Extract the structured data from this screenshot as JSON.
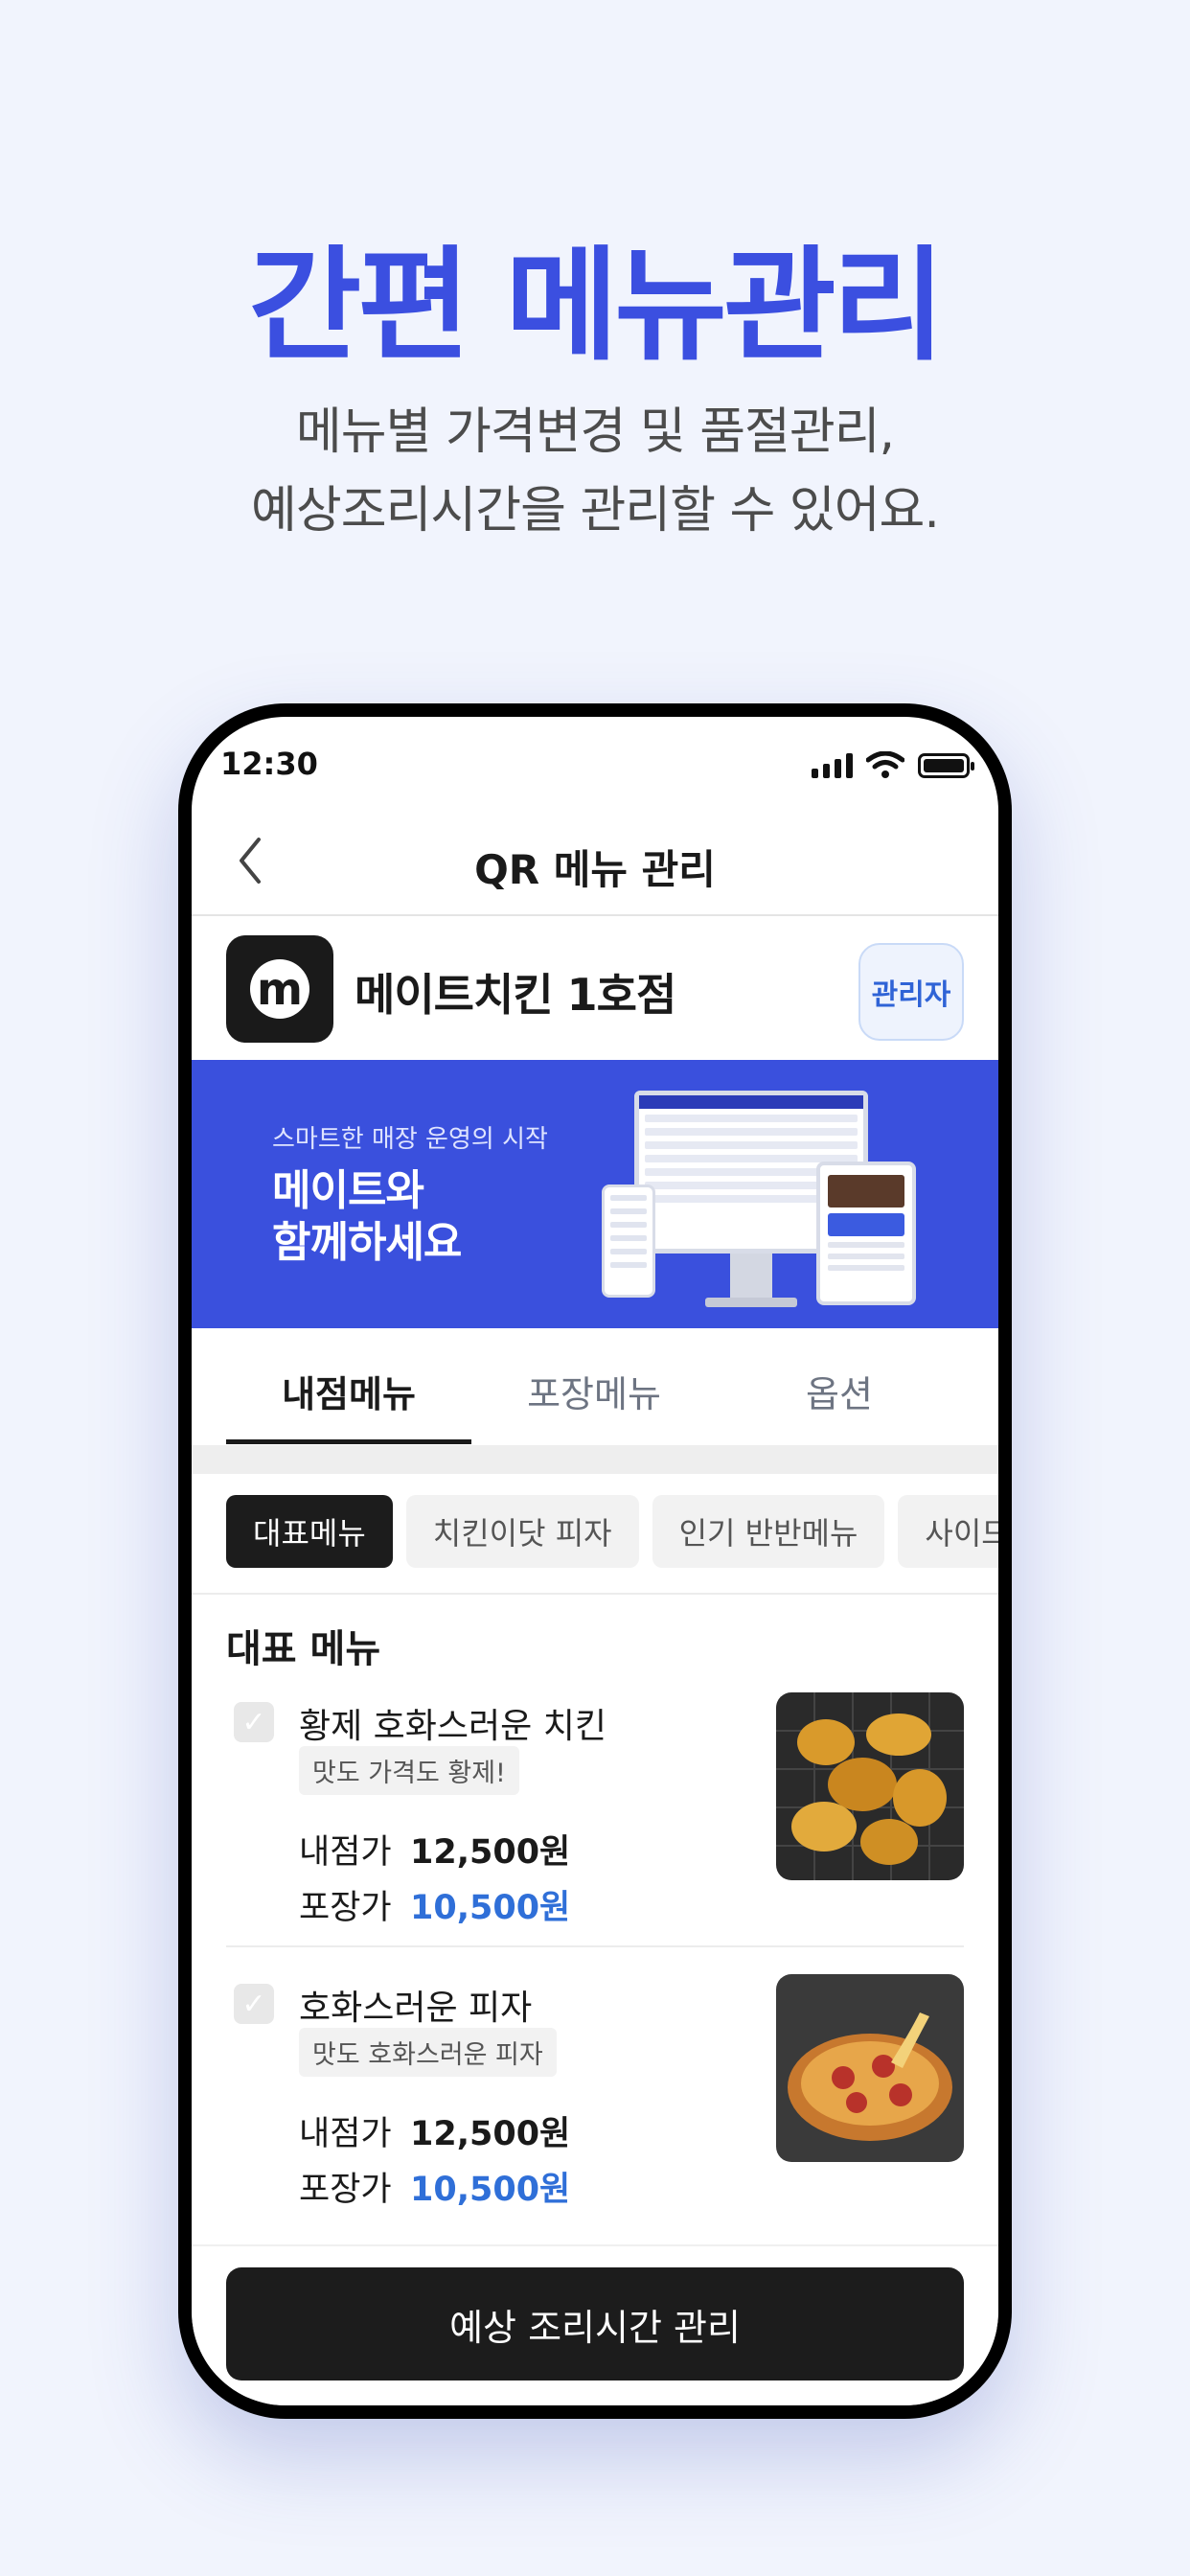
{
  "headline": "간편 메뉴관리",
  "subline1": "메뉴별 가격변경 및 품절관리,",
  "subline2": "예상조리시간을 관리할 수 있어요.",
  "status": {
    "time": "12:30"
  },
  "nav": {
    "back_icon": "chevron-left-icon",
    "title": "QR 메뉴 관리"
  },
  "store": {
    "logo_letter": "m",
    "name": "메이트치킨 1호점",
    "admin_label": "관리자"
  },
  "banner": {
    "sub": "스마트한 매장 운영의 시작",
    "main_line1": "메이트와",
    "main_line2": "함께하세요"
  },
  "tabs": [
    "내점메뉴",
    "포장메뉴",
    "옵션"
  ],
  "chips": [
    "대표메뉴",
    "치킨이닷 피자",
    "인기 반반메뉴",
    "사이드"
  ],
  "section_title": "대표 메뉴",
  "items": [
    {
      "name": "황제 호화스러운 치킨",
      "desc": "맛도 가격도 황제!",
      "dine_label": "내점가",
      "dine_price": "12,500원",
      "takeout_label": "포장가",
      "takeout_price": "10,500원"
    },
    {
      "name": "호화스러운 피자",
      "desc": "맛도 호화스러운 피자",
      "dine_label": "내점가",
      "dine_price": "12,500원",
      "takeout_label": "포장가",
      "takeout_price": "10,500원"
    }
  ],
  "cta_label": "예상 조리시간 관리",
  "colors": {
    "accent": "#3b4fe0",
    "banner": "#3a50dd",
    "price_blue": "#2f6fd8",
    "dark": "#1c1c1c"
  }
}
